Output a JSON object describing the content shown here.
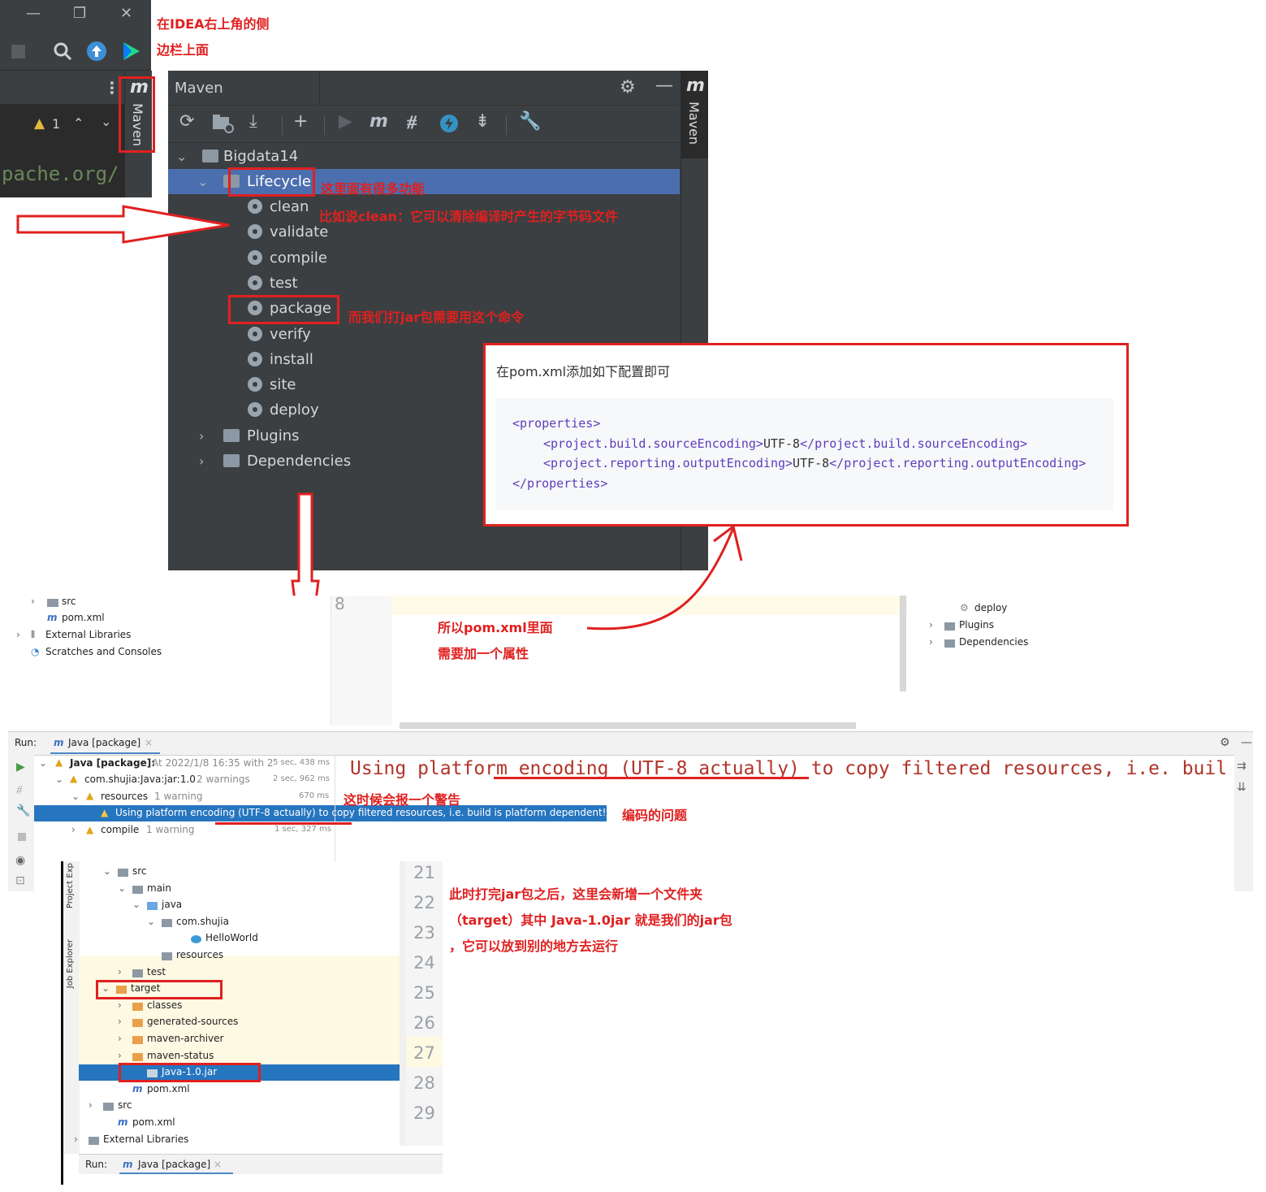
{
  "annotations": {
    "sidebar_note_line1": "在IDEA右上角的侧",
    "sidebar_note_line2": "边栏上面",
    "lifecycle_note": "这里面有很多功能",
    "clean_note": "比如说clean：它可以清除编译时产生的字节码文件",
    "package_note": "而我们打jar包需要用这个命令",
    "pom_note_line1": "所以pom.xml里面",
    "pom_note_line2": "需要加一个属性",
    "warning_note": "这时候会报一个警告",
    "encoding_note": "编码的问题",
    "target_note_line1": "此时打完jar包之后，这里会新增一个文件夹",
    "target_note_line2": "（target）其中 Java-1.0jar 就是我们的jar包",
    "target_note_line3": "，它可以放到别的地方去运行"
  },
  "top_left_snippet": {
    "warning_count": "1",
    "editor_text": "pache.org/",
    "maven_stripe_label": "Maven",
    "maven_stripe_logo": "m"
  },
  "maven_panel": {
    "title": "Maven",
    "stripe_label": "Maven",
    "stripe_logo": "m",
    "toolbar_icons": [
      "reload-icon",
      "add-folder-icon",
      "download-icon",
      "plus-icon",
      "run-icon",
      "maven-goal-icon",
      "toggle-offline-icon",
      "skip-tests-icon",
      "collapse-icon",
      "settings-wrench-icon"
    ],
    "project": "Bigdata14",
    "lifecycle_label": "Lifecycle",
    "lifecycle": [
      "clean",
      "validate",
      "compile",
      "test",
      "package",
      "verify",
      "install",
      "site",
      "deploy"
    ],
    "plugins_label": "Plugins",
    "dependencies_label": "Dependencies"
  },
  "code_box": {
    "intro": "在pom.xml添加如下配置即可",
    "lines": [
      {
        "open": "<properties>",
        "value": "",
        "close": ""
      },
      {
        "open": "<project.build.sourceEncoding>",
        "value": "UTF-8",
        "close": "</project.build.sourceEncoding>"
      },
      {
        "open": "<project.reporting.outputEncoding>",
        "value": "UTF-8",
        "close": "</project.reporting.outputEncoding>"
      },
      {
        "open": "</properties>",
        "value": "",
        "close": ""
      }
    ]
  },
  "middle_ide": {
    "project_items": [
      "src",
      "pom.xml",
      "External Libraries",
      "Scratches and Consoles"
    ],
    "line_number": "8",
    "right_items": [
      "deploy",
      "Plugins",
      "Dependencies"
    ],
    "run_label": "Run:",
    "run_tab": "Java [package]",
    "tree": [
      {
        "label": "Java [package]:",
        "detail": "At 2022/1/8 16:35 with 2",
        "time": "5 sec, 438 ms"
      },
      {
        "label": "com.shujia:Java:jar:1.0",
        "detail": "2 warnings",
        "time": "2 sec, 962 ms"
      },
      {
        "label": "resources",
        "detail": "1 warning",
        "time": "670 ms"
      },
      {
        "label": "Using platform encoding (UTF-8 actually) to copy filtered resources, i.e. build is platform dependent!",
        "detail": "",
        "time": ""
      },
      {
        "label": "compile",
        "detail": "1 warning",
        "time": "1 sec, 327 ms"
      }
    ],
    "console_text": "Using platform encoding (UTF-8 actually) to copy filtered resources, i.e. buil"
  },
  "bottom_ide": {
    "side_tabs": [
      "Project Exp",
      "Job Explorer"
    ],
    "tree": [
      "src",
      "main",
      "java",
      "com.shujia",
      "HelloWorld",
      "resources",
      "test",
      "target",
      "classes",
      "generated-sources",
      "maven-archiver",
      "maven-status",
      "Java-1.0.jar",
      "pom.xml",
      "src",
      "pom.xml",
      "External Libraries"
    ],
    "line_numbers": [
      "21",
      "22",
      "23",
      "24",
      "25",
      "26",
      "27",
      "28",
      "29"
    ],
    "run_label": "Run:",
    "run_tab": "Java [package]"
  },
  "colors": {
    "annotation_red": "#e02020",
    "darcula_bg": "#3c3f41",
    "selection_blue": "#4b6eaf",
    "light_selection": "#2675bf"
  }
}
